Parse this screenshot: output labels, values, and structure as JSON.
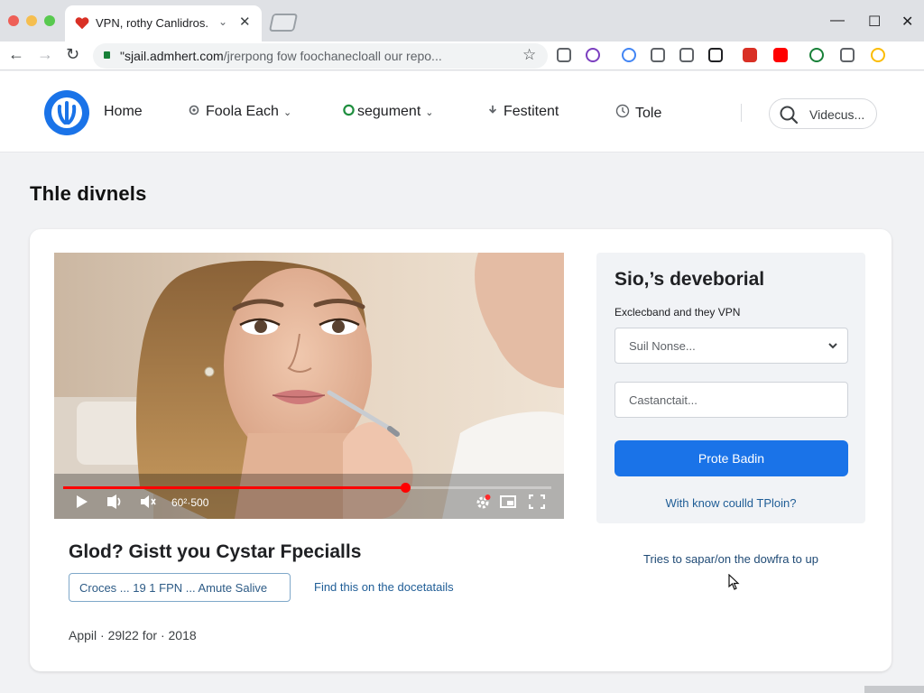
{
  "browser": {
    "tab_title": "VPN, rothy Canlidros.",
    "tab_menu_glyph": "⌄",
    "tab_close_glyph": "✕",
    "window_controls": {
      "minimize": "—",
      "maximize": "☐",
      "close": "✕"
    },
    "nav": {
      "back": "←",
      "forward": "→",
      "reload": "↻"
    },
    "url_host": "\"sjail.admhert.com",
    "url_path": "/jrerpong fow foochanecloall our repo...",
    "bookmark_glyph": "☆",
    "extensions": [
      {
        "name": "share-icon",
        "color": "#5f6368"
      },
      {
        "name": "profile-ext-icon",
        "color": "#7b3fbf"
      },
      {
        "name": "google-icon",
        "color": "#4285f4"
      },
      {
        "name": "reader-icon",
        "color": "#5f6368"
      },
      {
        "name": "settings-ext-icon",
        "color": "#5f6368"
      },
      {
        "name": "eye-icon",
        "color": "#202124"
      },
      {
        "name": "heart-ext-icon",
        "color": "#d93025"
      },
      {
        "name": "youtube-icon",
        "color": "#ff0000"
      },
      {
        "name": "circle-ext-icon",
        "color": "#188038"
      },
      {
        "name": "list-icon",
        "color": "#5f6368"
      },
      {
        "name": "chrome-icon",
        "color": "#fbbc04"
      }
    ]
  },
  "site": {
    "nav": {
      "home": "Home",
      "item2": "Foola Each",
      "item3": "segument",
      "item4": "Festitent",
      "item5": "Tole"
    },
    "caret": "⌄",
    "search_placeholder": "Videcus...",
    "accent": "#1a73e8"
  },
  "page": {
    "heading": "Thle divnels"
  },
  "video": {
    "time": "60²·500",
    "progress": 0.7,
    "title": "Glod? Gistt you Cystar Fpecialls",
    "chip": "Croces ... 19 1 FPN ... Amute Salive",
    "link": "Find this on the docetatails",
    "meta": "Appil · 29l22 for · 2018"
  },
  "panel": {
    "title": "Sio,’s deveborial",
    "label": "Exclecband and they VPN",
    "select_value": "Suil Nonse...",
    "input_placeholder": "Castanctait...",
    "button": "Prote Badin",
    "link": "With know coulld TPloin?",
    "below_text": "Tries to sapar/on the dowfra to up"
  }
}
